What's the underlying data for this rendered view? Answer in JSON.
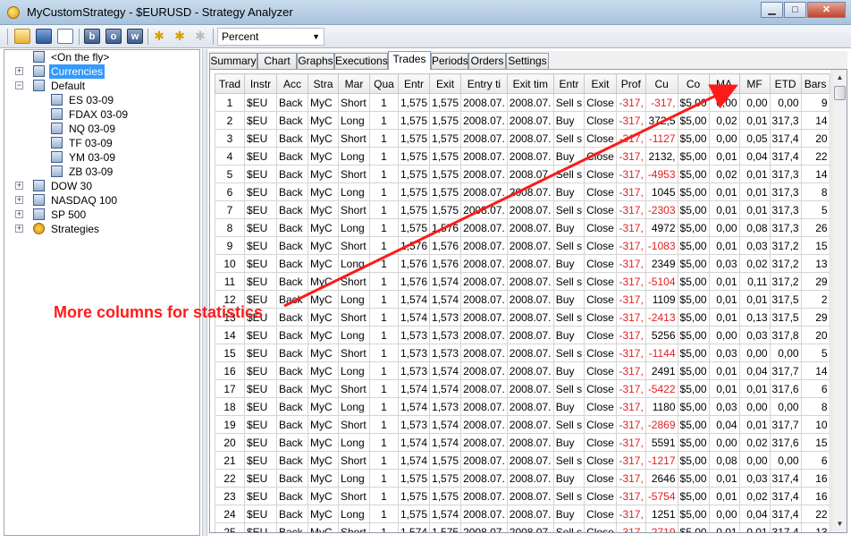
{
  "window": {
    "title": "MyCustomStrategy - $EURUSD - Strategy Analyzer",
    "minimize": "▁",
    "maximize": "□",
    "close": "✕"
  },
  "toolbar": {
    "display_mode": "Percent"
  },
  "tree": {
    "items": [
      {
        "label": "<On the fly>",
        "icon": "table-icon"
      },
      {
        "label": "Currencies",
        "icon": "folder-icon",
        "expander": "+"
      },
      {
        "label": "Default",
        "icon": "folder-icon",
        "expander": "−"
      },
      {
        "label": "ES 03-09",
        "icon": "table-icon"
      },
      {
        "label": "FDAX 03-09",
        "icon": "table-icon"
      },
      {
        "label": "NQ 03-09",
        "icon": "table-icon"
      },
      {
        "label": "TF 03-09",
        "icon": "table-icon"
      },
      {
        "label": "YM 03-09",
        "icon": "table-icon"
      },
      {
        "label": "ZB 03-09",
        "icon": "table-icon"
      },
      {
        "label": "DOW 30",
        "icon": "folder-icon",
        "expander": "+"
      },
      {
        "label": "NASDAQ 100",
        "icon": "folder-icon",
        "expander": "+"
      },
      {
        "label": "SP 500",
        "icon": "folder-icon",
        "expander": "+"
      },
      {
        "label": "Strategies",
        "icon": "coin-icon",
        "expander": "+"
      }
    ]
  },
  "tabs": [
    "Summary",
    "Chart",
    "Graphs",
    "Executions",
    "Trades",
    "Periods",
    "Orders",
    "Settings"
  ],
  "active_tab": "Trades",
  "columns": [
    "Trad",
    "Instr",
    "Acc",
    "Stra",
    "Mar",
    "Qua",
    "Entr",
    "Exit",
    "Entry ti",
    "Exit tim",
    "Entr",
    "Exit",
    "Prof",
    "Cu",
    "Co",
    "MA",
    "MF",
    "ETD",
    "Bars"
  ],
  "rows": [
    [
      "1",
      "$EU",
      "Back",
      "MyC",
      "Short",
      "1",
      "1,575",
      "1,575",
      "2008.07.",
      "2008.07.",
      "Sell s",
      "Close",
      "-317,",
      "-317,",
      "$5,00",
      "0,00",
      "0,00",
      "0,00",
      "9"
    ],
    [
      "2",
      "$EU",
      "Back",
      "MyC",
      "Long",
      "1",
      "1,575",
      "1,575",
      "2008.07.",
      "2008.07.",
      "Buy",
      "Close",
      "-317,",
      "372,5",
      "$5,00",
      "0,02",
      "0,01",
      "317,3",
      "14"
    ],
    [
      "3",
      "$EU",
      "Back",
      "MyC",
      "Short",
      "1",
      "1,575",
      "1,575",
      "2008.07.",
      "2008.07.",
      "Sell s",
      "Close",
      "-317,",
      "-1127",
      "$5,00",
      "0,00",
      "0,05",
      "317,4",
      "20"
    ],
    [
      "4",
      "$EU",
      "Back",
      "MyC",
      "Long",
      "1",
      "1,575",
      "1,575",
      "2008.07.",
      "2008.07.",
      "Buy",
      "Close",
      "-317,",
      "2132,",
      "$5,00",
      "0,01",
      "0,04",
      "317,4",
      "22"
    ],
    [
      "5",
      "$EU",
      "Back",
      "MyC",
      "Short",
      "1",
      "1,575",
      "1,575",
      "2008.07.",
      "2008.07.",
      "Sell s",
      "Close",
      "-317,",
      "-4953",
      "$5,00",
      "0,02",
      "0,01",
      "317,3",
      "14"
    ],
    [
      "6",
      "$EU",
      "Back",
      "MyC",
      "Long",
      "1",
      "1,575",
      "1,575",
      "2008.07.",
      "2008.07.",
      "Buy",
      "Close",
      "-317,",
      "1045",
      "$5,00",
      "0,01",
      "0,01",
      "317,3",
      "8"
    ],
    [
      "7",
      "$EU",
      "Back",
      "MyC",
      "Short",
      "1",
      "1,575",
      "1,575",
      "2008.07.",
      "2008.07.",
      "Sell s",
      "Close",
      "-317,",
      "-2303",
      "$5,00",
      "0,01",
      "0,01",
      "317,3",
      "5"
    ],
    [
      "8",
      "$EU",
      "Back",
      "MyC",
      "Long",
      "1",
      "1,575",
      "1,576",
      "2008.07.",
      "2008.07.",
      "Buy",
      "Close",
      "-317,",
      "4972",
      "$5,00",
      "0,00",
      "0,08",
      "317,3",
      "26"
    ],
    [
      "9",
      "$EU",
      "Back",
      "MyC",
      "Short",
      "1",
      "1,576",
      "1,576",
      "2008.07.",
      "2008.07.",
      "Sell s",
      "Close",
      "-317,",
      "-1083",
      "$5,00",
      "0,01",
      "0,03",
      "317,2",
      "15"
    ],
    [
      "10",
      "$EU",
      "Back",
      "MyC",
      "Long",
      "1",
      "1,576",
      "1,576",
      "2008.07.",
      "2008.07.",
      "Buy",
      "Close",
      "-317,",
      "2349",
      "$5,00",
      "0,03",
      "0,02",
      "317,2",
      "13"
    ],
    [
      "11",
      "$EU",
      "Back",
      "MyC",
      "Short",
      "1",
      "1,576",
      "1,574",
      "2008.07.",
      "2008.07.",
      "Sell s",
      "Close",
      "-317,",
      "-5104",
      "$5,00",
      "0,01",
      "0,11",
      "317,2",
      "29"
    ],
    [
      "12",
      "$EU",
      "Back",
      "MyC",
      "Long",
      "1",
      "1,574",
      "1,574",
      "2008.07.",
      "2008.07.",
      "Buy",
      "Close",
      "-317,",
      "1109",
      "$5,00",
      "0,01",
      "0,01",
      "317,5",
      "2"
    ],
    [
      "13",
      "$EU",
      "Back",
      "MyC",
      "Short",
      "1",
      "1,574",
      "1,573",
      "2008.07.",
      "2008.07.",
      "Sell s",
      "Close",
      "-317,",
      "-2413",
      "$5,00",
      "0,01",
      "0,13",
      "317,5",
      "29"
    ],
    [
      "14",
      "$EU",
      "Back",
      "MyC",
      "Long",
      "1",
      "1,573",
      "1,573",
      "2008.07.",
      "2008.07.",
      "Buy",
      "Close",
      "-317,",
      "5256",
      "$5,00",
      "0,00",
      "0,03",
      "317,8",
      "20"
    ],
    [
      "15",
      "$EU",
      "Back",
      "MyC",
      "Short",
      "1",
      "1,573",
      "1,573",
      "2008.07.",
      "2008.07.",
      "Sell s",
      "Close",
      "-317,",
      "-1144",
      "$5,00",
      "0,03",
      "0,00",
      "0,00",
      "5"
    ],
    [
      "16",
      "$EU",
      "Back",
      "MyC",
      "Long",
      "1",
      "1,573",
      "1,574",
      "2008.07.",
      "2008.07.",
      "Buy",
      "Close",
      "-317,",
      "2491",
      "$5,00",
      "0,01",
      "0,04",
      "317,7",
      "14"
    ],
    [
      "17",
      "$EU",
      "Back",
      "MyC",
      "Short",
      "1",
      "1,574",
      "1,574",
      "2008.07.",
      "2008.07.",
      "Sell s",
      "Close",
      "-317,",
      "-5422",
      "$5,00",
      "0,01",
      "0,01",
      "317,6",
      "6"
    ],
    [
      "18",
      "$EU",
      "Back",
      "MyC",
      "Long",
      "1",
      "1,574",
      "1,573",
      "2008.07.",
      "2008.07.",
      "Buy",
      "Close",
      "-317,",
      "1180",
      "$5,00",
      "0,03",
      "0,00",
      "0,00",
      "8"
    ],
    [
      "19",
      "$EU",
      "Back",
      "MyC",
      "Short",
      "1",
      "1,573",
      "1,574",
      "2008.07.",
      "2008.07.",
      "Sell s",
      "Close",
      "-317,",
      "-2869",
      "$5,00",
      "0,04",
      "0,01",
      "317,7",
      "10"
    ],
    [
      "20",
      "$EU",
      "Back",
      "MyC",
      "Long",
      "1",
      "1,574",
      "1,574",
      "2008.07.",
      "2008.07.",
      "Buy",
      "Close",
      "-317,",
      "5591",
      "$5,00",
      "0,00",
      "0,02",
      "317,6",
      "15"
    ],
    [
      "21",
      "$EU",
      "Back",
      "MyC",
      "Short",
      "1",
      "1,574",
      "1,575",
      "2008.07.",
      "2008.07.",
      "Sell s",
      "Close",
      "-317,",
      "-1217",
      "$5,00",
      "0,08",
      "0,00",
      "0,00",
      "6"
    ],
    [
      "22",
      "$EU",
      "Back",
      "MyC",
      "Long",
      "1",
      "1,575",
      "1,575",
      "2008.07.",
      "2008.07.",
      "Buy",
      "Close",
      "-317,",
      "2646",
      "$5,00",
      "0,01",
      "0,03",
      "317,4",
      "16"
    ],
    [
      "23",
      "$EU",
      "Back",
      "MyC",
      "Short",
      "1",
      "1,575",
      "1,575",
      "2008.07.",
      "2008.07.",
      "Sell s",
      "Close",
      "-317,",
      "-5754",
      "$5,00",
      "0,01",
      "0,02",
      "317,4",
      "16"
    ],
    [
      "24",
      "$EU",
      "Back",
      "MyC",
      "Long",
      "1",
      "1,575",
      "1,574",
      "2008.07.",
      "2008.07.",
      "Buy",
      "Close",
      "-317,",
      "1251",
      "$5,00",
      "0,00",
      "0,04",
      "317,4",
      "22"
    ],
    [
      "25",
      "$EU",
      "Back",
      "MyC",
      "Short",
      "1",
      "1,574",
      "1,575",
      "2008.07.",
      "2008.07.",
      "Sell s",
      "Close",
      "-317,",
      "-2719",
      "$5,00",
      "0,01",
      "0,01",
      "317,4",
      "13"
    ]
  ],
  "annotation": {
    "text": "More columns for statistics",
    "color": "#ff1a1a"
  },
  "colors": {
    "negative": "#e02020",
    "selection": "#3399ff"
  }
}
